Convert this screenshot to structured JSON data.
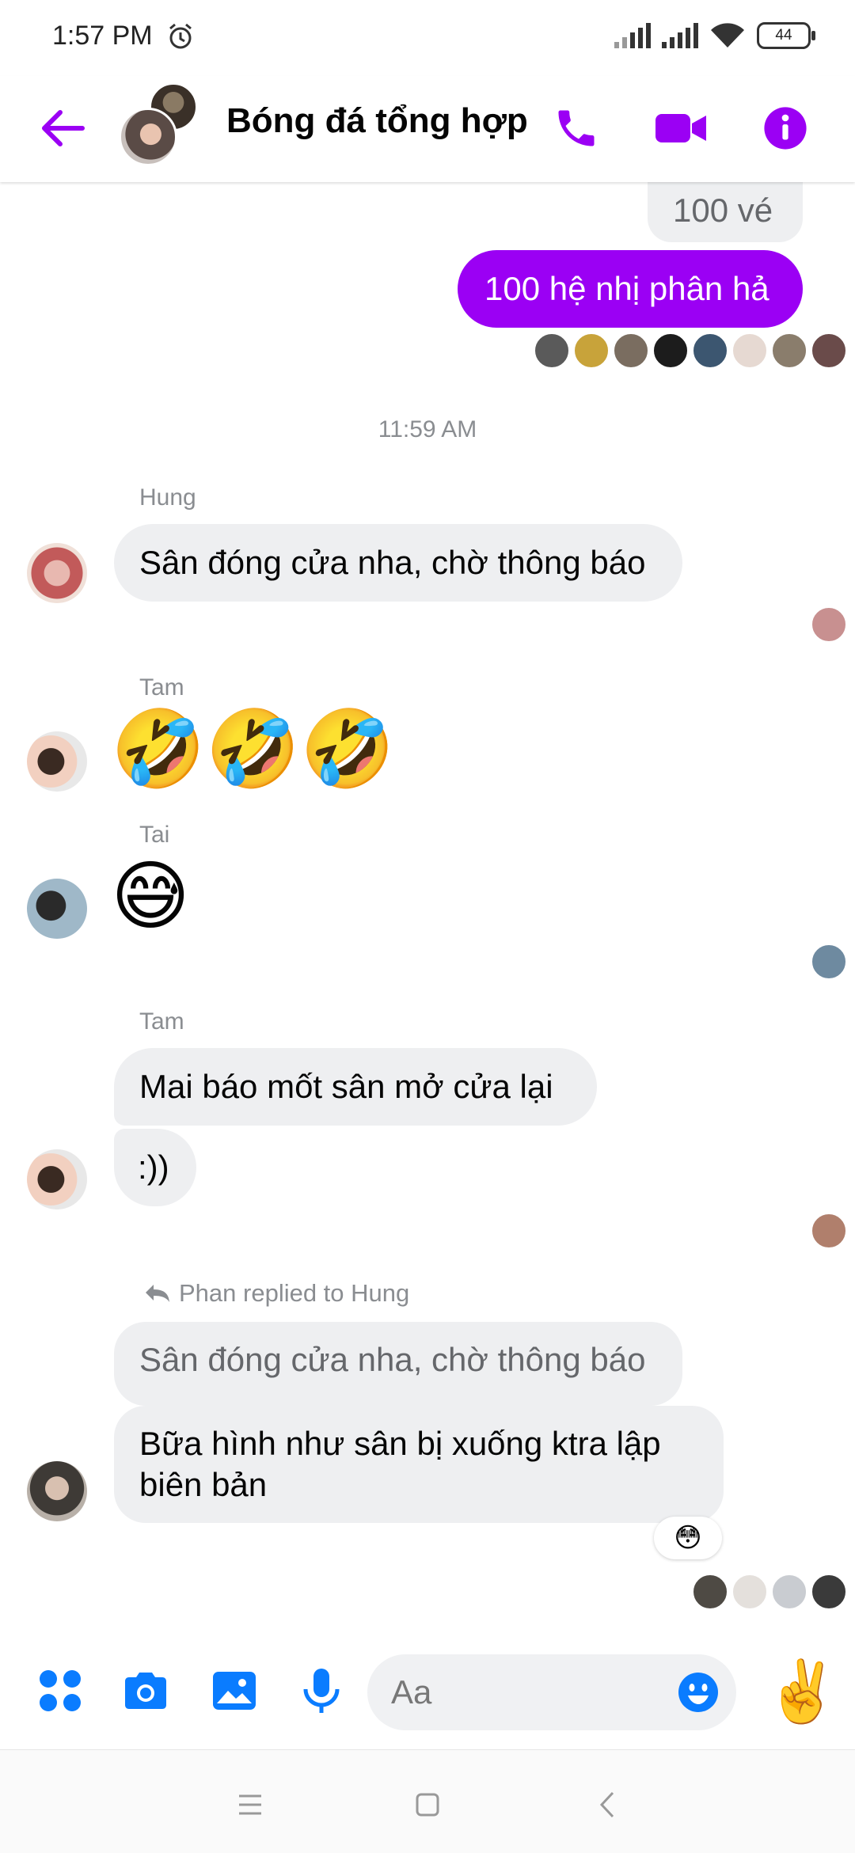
{
  "status_bar": {
    "time": "1:57 PM",
    "battery": "44"
  },
  "header": {
    "title": "Bóng đá tổng hợp"
  },
  "colors": {
    "accent": "#9b00f4",
    "blue": "#0a7cff"
  },
  "messages": {
    "top_quote": "100 vé",
    "my_message": "100 hệ nhị phân hả",
    "timestamp": "11:59 AM",
    "hung_name": "Hung",
    "hung_msg": "Sân đóng cửa nha, chờ thông báo",
    "tam_name_1": "Tam",
    "tam_emoji": "🤣🤣🤣",
    "tai_name": "Tai",
    "tai_emoji": "😅",
    "tam_name_2": "Tam",
    "tam_msg_1": "Mai báo mốt sân mở cửa lại",
    "tam_msg_2": ":))",
    "reply_label": "Phan replied to Hung",
    "reply_quote": "Sân đóng cửa nha, chờ thông báo",
    "phan_msg_line1": "Bữa hình như sân bị xuống ktra lập",
    "phan_msg_line2": "biên bản",
    "reaction": "😳"
  },
  "composer": {
    "placeholder": "Aa",
    "thumb_emoji": "✌️"
  },
  "icons": {
    "header": [
      "back-arrow-icon",
      "phone-icon",
      "video-camera-icon",
      "info-icon"
    ],
    "composer": [
      "apps-menu-icon",
      "camera-icon",
      "gallery-icon",
      "microphone-icon",
      "emoji-icon"
    ],
    "nav": [
      "menu-icon",
      "home-icon",
      "back-icon"
    ]
  }
}
